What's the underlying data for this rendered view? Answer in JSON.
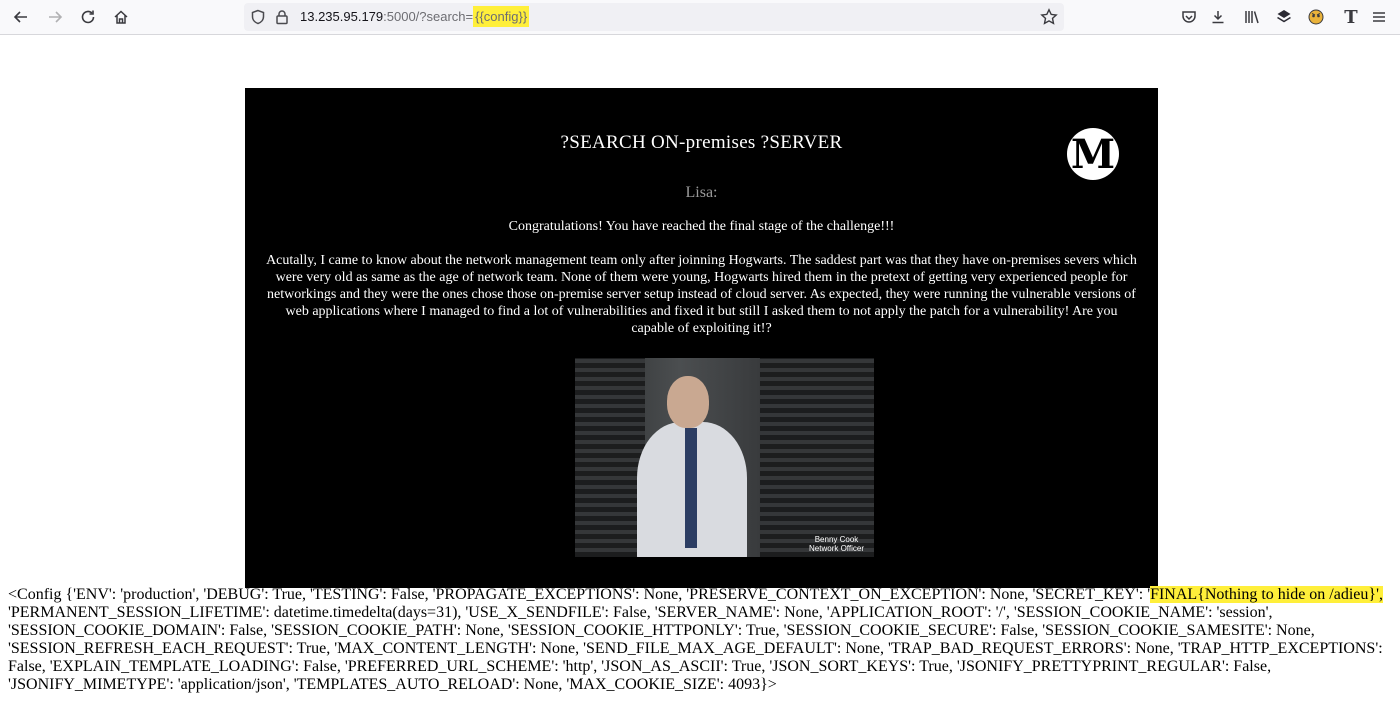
{
  "browser": {
    "url_host": "13.235.95.179",
    "url_path": ":5000/?search=",
    "url_query_highlight": "{{config}}",
    "icons": [
      "back-arrow-icon",
      "forward-arrow-icon",
      "reload-icon",
      "home-icon",
      "shield-icon",
      "lock-icon",
      "star-icon",
      "pocket-icon",
      "download-icon",
      "library-icon",
      "extension-icon",
      "extension-face-icon",
      "font-icon"
    ]
  },
  "panel": {
    "title": "?SEARCH ON-premises ?SERVER",
    "logo_letter": "M",
    "speaker": "Lisa:",
    "congrats": "Congratulations! You have reached the final stage of the challenge!!!",
    "story": "Acutally, I came to know about the network management team only after joinning Hogwarts. The saddest part was that they have on-premises severs which were very old as same as the age of network team. None of them were young, Hogwarts hired them in the pretext of getting very experienced people for networkings and they were the ones chose those on-premise server setup instead of cloud server. As expected, they were running the vulnerable versions of web applications where I managed to find a lot of vulnerabilities and fixed it but still I asked them to not apply the patch for a vulnerability! Are you capable of exploiting it!?",
    "photo_caption_line1": "Benny Cook",
    "photo_caption_line2": "Network Officer"
  },
  "config_output": {
    "before": "<Config {'ENV': 'production', 'DEBUG': True, 'TESTING': False, 'PROPAGATE_EXCEPTIONS': None, 'PRESERVE_CONTEXT_ON_EXCEPTION': None, 'SECRET_KEY': '",
    "highlight": "FINAL{Nothing to hide on /adieu}',",
    "after": " 'PERMANENT_SESSION_LIFETIME': datetime.timedelta(days=31), 'USE_X_SENDFILE': False, 'SERVER_NAME': None, 'APPLICATION_ROOT': '/', 'SESSION_COOKIE_NAME': 'session', 'SESSION_COOKIE_DOMAIN': False, 'SESSION_COOKIE_PATH': None, 'SESSION_COOKIE_HTTPONLY': True, 'SESSION_COOKIE_SECURE': False, 'SESSION_COOKIE_SAMESITE': None, 'SESSION_REFRESH_EACH_REQUEST': True, 'MAX_CONTENT_LENGTH': None, 'SEND_FILE_MAX_AGE_DEFAULT': None, 'TRAP_BAD_REQUEST_ERRORS': None, 'TRAP_HTTP_EXCEPTIONS': False, 'EXPLAIN_TEMPLATE_LOADING': False, 'PREFERRED_URL_SCHEME': 'http', 'JSON_AS_ASCII': True, 'JSON_SORT_KEYS': True, 'JSONIFY_PRETTYPRINT_REGULAR': False, 'JSONIFY_MIMETYPE': 'application/json', 'TEMPLATES_AUTO_RELOAD': None, 'MAX_COOKIE_SIZE': 4093}>"
  },
  "colors": {
    "highlight": "#ffef3a",
    "panel_bg": "#000000",
    "toolbar_bg": "#f9f9fb"
  }
}
